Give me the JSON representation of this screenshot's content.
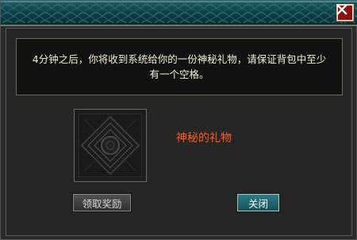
{
  "dialog": {
    "close_icon": "close-x-icon",
    "message": "4分钟之后，你将收到系统给你的一份神秘礼物，请保证背包中至少有一个空格。",
    "item_slot_icon": "mystery-gift-box-icon",
    "gift_name": "神秘的礼物",
    "claim_button": "领取奖励",
    "close_button": "关闭",
    "colors": {
      "gift_name": "#ff5a1e",
      "header_teal": "#1d5c63",
      "message_text": "#f0eed6"
    }
  }
}
